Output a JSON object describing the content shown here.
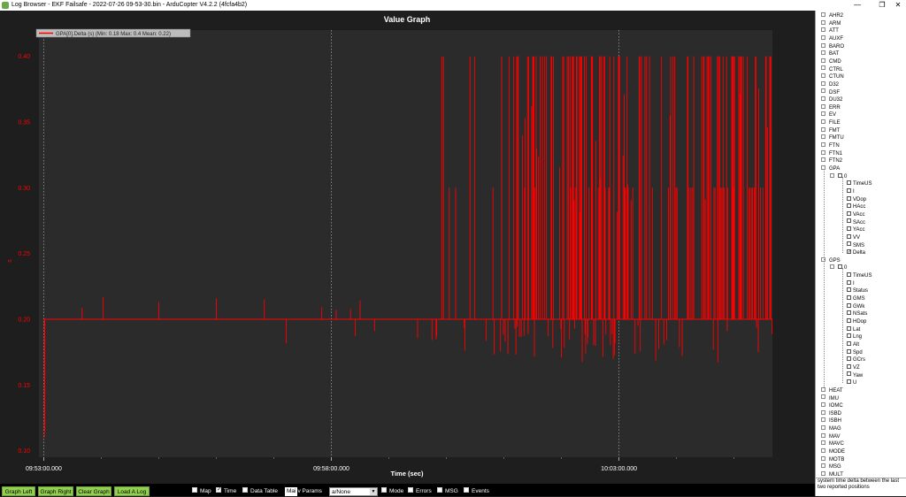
{
  "window": {
    "title": "Log Browser - EKF Failsafe - 2022-07-26 09-53-30.bin - ArduCopter V4.2.2 (4fcfa4b2)"
  },
  "graph": {
    "title": "Value Graph",
    "legend": "GPA[0].Delta (s)  (Min: 0.18 Max: 0.4 Mean: 0.22)",
    "xlabel": "Time (sec)",
    "ylabel": "s"
  },
  "chart_data": {
    "type": "line",
    "title": "Value Graph",
    "xlabel": "Time (sec)",
    "ylabel": "s",
    "series": [
      {
        "name": "GPA[0].Delta (s)",
        "color": "#ff0000"
      }
    ],
    "y_ticks": [
      "0.40",
      "0.35",
      "0.30",
      "0.25",
      "0.20",
      "0.15",
      "0.10"
    ],
    "y_tick_values": [
      0.4,
      0.35,
      0.3,
      0.25,
      0.2,
      0.15,
      0.1
    ],
    "ylim": [
      0.095,
      0.42
    ],
    "x_ticks": [
      "09:53:00.000",
      "09:58:00.000",
      "10:03:00.000"
    ],
    "xlim_seconds_from_first_tick": [
      -5,
      760
    ],
    "x_tick_seconds": [
      0,
      300,
      600
    ],
    "min": 0.18,
    "max": 0.4,
    "mean": 0.22,
    "baseline": 0.2,
    "spike_levels": [
      0.4,
      0.3,
      0.18,
      0.17,
      0.16
    ]
  },
  "tree": {
    "top_items": [
      "AHR2",
      "ARM",
      "ATT",
      "AUXF",
      "BARO",
      "BAT",
      "CMD",
      "CTRL",
      "CTUN",
      "D32",
      "DSF",
      "DU32",
      "ERR",
      "EV",
      "FILE",
      "FMT",
      "FMTU",
      "FTN",
      "FTN1",
      "FTN2"
    ],
    "gpa": {
      "label": "GPA",
      "instance": "0",
      "fields": [
        {
          "label": "TimeUS",
          "checked": false
        },
        {
          "label": "I",
          "checked": false
        },
        {
          "label": "VDop",
          "checked": false
        },
        {
          "label": "HAcc",
          "checked": false
        },
        {
          "label": "VAcc",
          "checked": false
        },
        {
          "label": "SAcc",
          "checked": false
        },
        {
          "label": "YAcc",
          "checked": false
        },
        {
          "label": "VV",
          "checked": false
        },
        {
          "label": "SMS",
          "checked": false
        },
        {
          "label": "Delta",
          "checked": true
        }
      ]
    },
    "gps": {
      "label": "GPS",
      "instance": "0",
      "fields": [
        {
          "label": "TimeUS",
          "checked": false
        },
        {
          "label": "I",
          "checked": false
        },
        {
          "label": "Status",
          "checked": false
        },
        {
          "label": "GMS",
          "checked": false
        },
        {
          "label": "GWk",
          "checked": false
        },
        {
          "label": "NSats",
          "checked": false
        },
        {
          "label": "HDop",
          "checked": false
        },
        {
          "label": "Lat",
          "checked": false
        },
        {
          "label": "Lng",
          "checked": false
        },
        {
          "label": "Alt",
          "checked": false
        },
        {
          "label": "Spd",
          "checked": false
        },
        {
          "label": "GCrs",
          "checked": false
        },
        {
          "label": "VZ",
          "checked": false
        },
        {
          "label": "Yaw",
          "checked": false
        },
        {
          "label": "U",
          "checked": false
        }
      ]
    },
    "bottom_items": [
      "HEAT",
      "IMU",
      "IOMC",
      "ISBD",
      "ISBH",
      "MAG",
      "MAV",
      "MAVC",
      "MODE",
      "MOTB",
      "MSG",
      "MULT"
    ]
  },
  "tooltip": "system time delta between the last two reported positions",
  "toolbar": {
    "buttons": [
      "Graph Left",
      "Graph Right",
      "Clear Graph",
      "Load A Log"
    ],
    "checkboxes": [
      {
        "label": "Map",
        "checked": false
      },
      {
        "label": "Time",
        "checked": true
      },
      {
        "label": "Data Table",
        "checked": false
      }
    ],
    "mav_tab": "Mai",
    "mav_rest": "v Params",
    "param_select": "a/None",
    "checkboxes2": [
      {
        "label": "Mode",
        "checked": false
      },
      {
        "label": "Errors",
        "checked": false
      },
      {
        "label": "MSG",
        "checked": false
      },
      {
        "label": "Events",
        "checked": false
      }
    ]
  },
  "colors": {
    "plot_bg": "#2b2b2b",
    "line": "#ff0000",
    "axis_text": "#ff0000",
    "button": "#92d050"
  }
}
